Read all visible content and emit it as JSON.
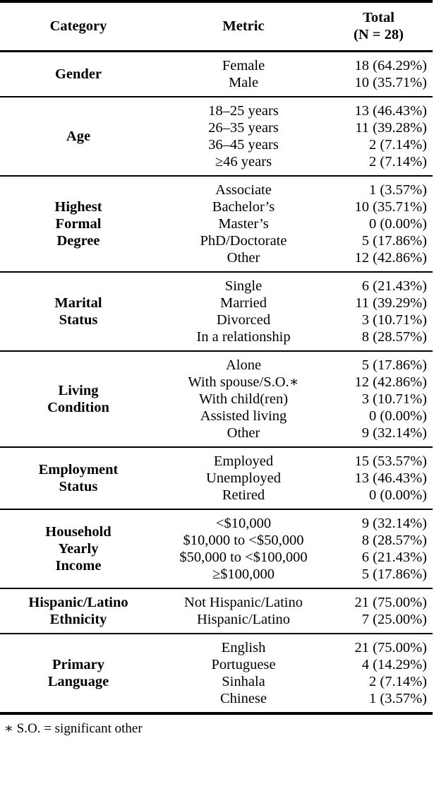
{
  "table": {
    "headers": {
      "category": "Category",
      "metric": "Metric",
      "total_line1": "Total",
      "total_line2": "(N = 28)"
    },
    "groups": [
      {
        "category": "Gender",
        "rows": [
          {
            "metric": "Female",
            "total": "18 (64.29%)"
          },
          {
            "metric": "Male",
            "total": "10 (35.71%)"
          }
        ]
      },
      {
        "category": "Age",
        "rows": [
          {
            "metric": "18–25 years",
            "total": "13 (46.43%)"
          },
          {
            "metric": "26–35 years",
            "total": "11 (39.28%)"
          },
          {
            "metric": "36–45 years",
            "total": "2 (7.14%)"
          },
          {
            "metric": "≥46 years",
            "total": "2 (7.14%)"
          }
        ]
      },
      {
        "category": "Highest\nFormal\nDegree",
        "rows": [
          {
            "metric": "Associate",
            "total": "1 (3.57%)"
          },
          {
            "metric": "Bachelor’s",
            "total": "10 (35.71%)"
          },
          {
            "metric": "Master’s",
            "total": "0 (0.00%)"
          },
          {
            "metric": "PhD/Doctorate",
            "total": "5 (17.86%)"
          },
          {
            "metric": "Other",
            "total": "12 (42.86%)"
          }
        ]
      },
      {
        "category": "Marital\nStatus",
        "rows": [
          {
            "metric": "Single",
            "total": "6 (21.43%)"
          },
          {
            "metric": "Married",
            "total": "11 (39.29%)"
          },
          {
            "metric": "Divorced",
            "total": "3 (10.71%)"
          },
          {
            "metric": "In a relationship",
            "total": "8 (28.57%)"
          }
        ]
      },
      {
        "category": "Living\nCondition",
        "rows": [
          {
            "metric": "Alone",
            "total": "5 (17.86%)"
          },
          {
            "metric": "With spouse/S.O.∗",
            "total": "12 (42.86%)"
          },
          {
            "metric": "With child(ren)",
            "total": "3 (10.71%)"
          },
          {
            "metric": "Assisted living",
            "total": "0 (0.00%)"
          },
          {
            "metric": "Other",
            "total": "9 (32.14%)"
          }
        ]
      },
      {
        "category": "Employment\nStatus",
        "rows": [
          {
            "metric": "Employed",
            "total": "15 (53.57%)"
          },
          {
            "metric": "Unemployed",
            "total": "13 (46.43%)"
          },
          {
            "metric": "Retired",
            "total": "0 (0.00%)"
          }
        ]
      },
      {
        "category": "Household\nYearly\nIncome",
        "rows": [
          {
            "metric": "<$10,000",
            "total": "9 (32.14%)"
          },
          {
            "metric": "$10,000 to <$50,000",
            "total": "8 (28.57%)"
          },
          {
            "metric": "$50,000 to <$100,000",
            "total": "6 (21.43%)"
          },
          {
            "metric": "≥$100,000",
            "total": "5 (17.86%)"
          }
        ]
      },
      {
        "category": "Hispanic/Latino\nEthnicity",
        "rows": [
          {
            "metric": "Not Hispanic/Latino",
            "total": "21 (75.00%)"
          },
          {
            "metric": "Hispanic/Latino",
            "total": "7 (25.00%)"
          }
        ]
      },
      {
        "category": "Primary\nLanguage",
        "rows": [
          {
            "metric": "English",
            "total": "21 (75.00%)"
          },
          {
            "metric": "Portuguese",
            "total": "4 (14.29%)"
          },
          {
            "metric": "Sinhala",
            "total": "2 (7.14%)"
          },
          {
            "metric": "Chinese",
            "total": "1 (3.57%)"
          }
        ]
      }
    ],
    "footnote": "∗ S.O. = significant other"
  }
}
